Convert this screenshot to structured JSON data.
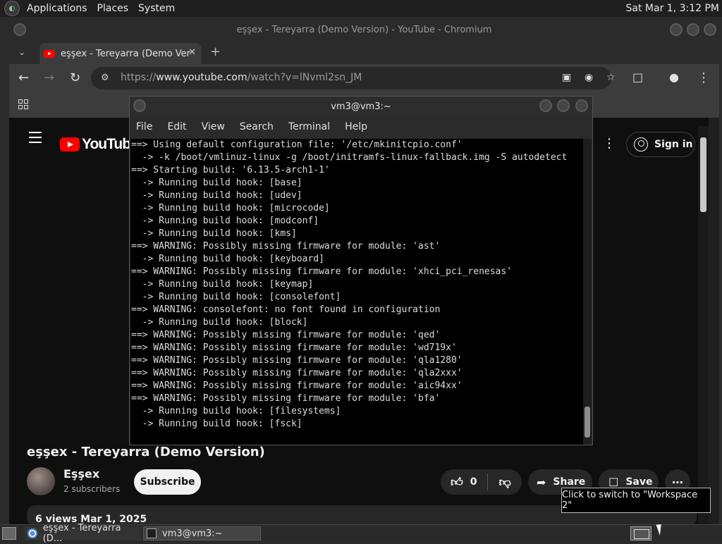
{
  "top_panel": {
    "menus": [
      "Applications",
      "Places",
      "System"
    ],
    "clock": "Sat Mar  1,  3:12 PM"
  },
  "chromium": {
    "window_title": "eşşex - Tereyarra (Demo Version) - YouTube - Chromium",
    "tab_title": "eşşex - Tereyarra (Demo Ver",
    "url_prefix": "https://",
    "url_host": "www.youtube.com",
    "url_path": "/watch?v=lNvml2sn_JM",
    "icons": {
      "tab_dropdown": "chevron-down-icon",
      "new_tab": "plus-icon",
      "back": "arrow-left-icon",
      "forward": "arrow-right-icon",
      "reload": "reload-icon",
      "site_info": "tune-icon",
      "install": "install-app-icon",
      "eye": "eye-off-icon",
      "star": "star-icon",
      "extensions": "puzzle-icon",
      "profile": "profile-icon",
      "menu": "kebab-icon",
      "apps": "apps-grid-icon"
    }
  },
  "youtube": {
    "logo_text": "YouTube",
    "sign_in": "Sign in",
    "video_title": "eşşex - Tereyarra (Demo Version)",
    "channel": "Eşşex",
    "subscribers": "2 subscribers",
    "subscribe": "Subscribe",
    "likes": "0",
    "share": "Share",
    "save": "Save",
    "description": "6 views  Mar 1, 2025"
  },
  "terminal": {
    "title": "vm3@vm3:~",
    "menu": [
      "File",
      "Edit",
      "View",
      "Search",
      "Terminal",
      "Help"
    ],
    "lines": [
      "==> Using default configuration file: '/etc/mkinitcpio.conf'",
      "  -> -k /boot/vmlinuz-linux -g /boot/initramfs-linux-fallback.img -S autodetect",
      "==> Starting build: '6.13.5-arch1-1'",
      "  -> Running build hook: [base]",
      "  -> Running build hook: [udev]",
      "  -> Running build hook: [microcode]",
      "  -> Running build hook: [modconf]",
      "  -> Running build hook: [kms]",
      "==> WARNING: Possibly missing firmware for module: 'ast'",
      "  -> Running build hook: [keyboard]",
      "==> WARNING: Possibly missing firmware for module: 'xhci_pci_renesas'",
      "  -> Running build hook: [keymap]",
      "  -> Running build hook: [consolefont]",
      "==> WARNING: consolefont: no font found in configuration",
      "  -> Running build hook: [block]",
      "==> WARNING: Possibly missing firmware for module: 'qed'",
      "==> WARNING: Possibly missing firmware for module: 'wd719x'",
      "==> WARNING: Possibly missing firmware for module: 'qla1280'",
      "==> WARNING: Possibly missing firmware for module: 'qla2xxx'",
      "==> WARNING: Possibly missing firmware for module: 'aic94xx'",
      "==> WARNING: Possibly missing firmware for module: 'bfa'",
      "  -> Running build hook: [filesystems]",
      "  -> Running build hook: [fsck]"
    ]
  },
  "tooltip": "Click to switch to \"Workspace 2\"",
  "taskbar": {
    "items": [
      "eşşex - Tereyarra (D...",
      "vm3@vm3:~"
    ]
  }
}
